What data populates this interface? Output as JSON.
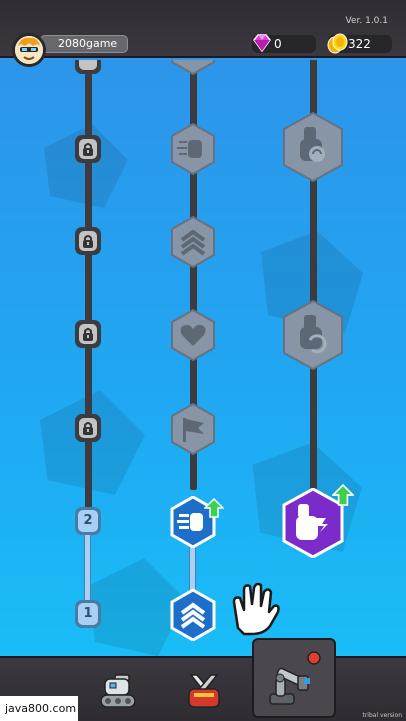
{
  "header": {
    "version": "Ver. 1.0.1",
    "username": "2080game",
    "gems": "0",
    "coins": "322"
  },
  "tracks": {
    "left": {
      "locked_nodes": 4,
      "level_nodes": [
        "2",
        "1"
      ]
    }
  },
  "skills": {
    "column_middle": [
      "punch-skill-locked",
      "rank-skill-locked",
      "heart-skill-locked",
      "flag-skill-locked",
      "rapid-punch-skill-unlocked",
      "rank-skill-unlocked"
    ],
    "column_right": [
      "fist-skill-locked",
      "fist-recoil-skill-locked",
      "power-fist-skill-unlocked"
    ]
  },
  "bottom_nav": {
    "items": [
      "tank-tab",
      "weapons-tab",
      "robot-arm-tab"
    ],
    "selected": "robot-arm-tab"
  },
  "overlay": {
    "watermark": "java800.com",
    "corner_tag": "tribal version"
  },
  "colors": {
    "background_top": "#2d95ea",
    "background_bottom": "#19bdf7",
    "locked_hex": "#8795a6",
    "unlocked_blue": "#1d6fc9",
    "unlocked_purple": "#7b2bc9",
    "upgrade_arrow": "#3bd14b"
  }
}
